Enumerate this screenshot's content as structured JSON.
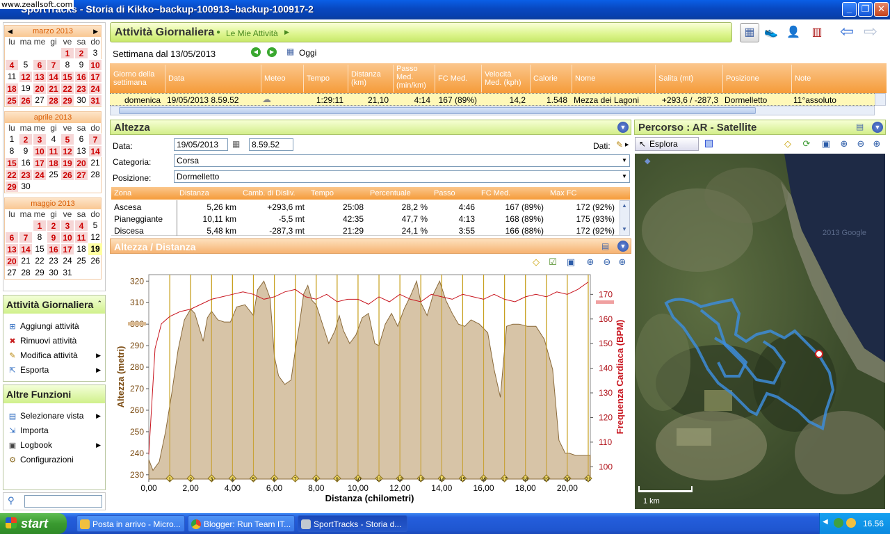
{
  "window": {
    "title": "SportTracks - Storia di Kikko~backup-100913~backup-100917-2",
    "watermark": "www.zeallsoft.com"
  },
  "calendar": {
    "weekdays": [
      "lu",
      "ma",
      "me",
      "gi",
      "ve",
      "sa",
      "do"
    ],
    "months": [
      {
        "name": "marzo 2013",
        "days": [
          "",
          "",
          "",
          "",
          "1",
          "2",
          "3",
          "4",
          "5",
          "6",
          "7",
          "8",
          "9",
          "10",
          "11",
          "12",
          "13",
          "14",
          "15",
          "16",
          "17",
          "18",
          "19",
          "20",
          "21",
          "22",
          "23",
          "24",
          "25",
          "26",
          "27",
          "28",
          "29",
          "30",
          "31"
        ]
      },
      {
        "name": "aprile 2013",
        "days": [
          "1",
          "2",
          "3",
          "4",
          "5",
          "6",
          "7",
          "8",
          "9",
          "10",
          "11",
          "12",
          "13",
          "14",
          "15",
          "16",
          "17",
          "18",
          "19",
          "20",
          "21",
          "22",
          "23",
          "24",
          "25",
          "26",
          "27",
          "28",
          "29",
          "30"
        ]
      },
      {
        "name": "maggio 2013",
        "days": [
          "",
          "",
          "1",
          "2",
          "3",
          "4",
          "5",
          "6",
          "7",
          "8",
          "9",
          "10",
          "11",
          "12",
          "13",
          "14",
          "15",
          "16",
          "17",
          "18",
          "19",
          "20",
          "21",
          "22",
          "23",
          "24",
          "25",
          "26",
          "27",
          "28",
          "29",
          "30",
          "31"
        ]
      }
    ]
  },
  "sidebar": {
    "section1": {
      "title": "Attività Giornaliera",
      "items": [
        {
          "label": "Aggiungi attività",
          "icon": "add-icon"
        },
        {
          "label": "Rimuovi attività",
          "icon": "remove-icon"
        },
        {
          "label": "Modifica attività",
          "icon": "pencil-icon"
        },
        {
          "label": "Esporta",
          "icon": "export-icon"
        }
      ]
    },
    "section2": {
      "title": "Altre Funzioni",
      "items": [
        {
          "label": "Selezionare vista",
          "icon": "view-icon"
        },
        {
          "label": "Importa",
          "icon": "import-icon"
        },
        {
          "label": "Logbook",
          "icon": "logbook-icon"
        },
        {
          "label": "Configurazioni",
          "icon": "gear-icon"
        }
      ]
    }
  },
  "header": {
    "title": "Attività Giornaliera",
    "crumb": "Le Mie Attività"
  },
  "week": {
    "label": "Settimana dal 13/05/2013",
    "today": "Oggi"
  },
  "activities": {
    "columns": [
      "Giorno della settimana",
      "Data",
      "Meteo",
      "Tempo",
      "Distanza (km)",
      "Passo Med. (min/km)",
      "FC Med.",
      "Velocità Med. (kph)",
      "Calorie",
      "Nome",
      "Salita (mt)",
      "Posizione",
      "Note"
    ],
    "row": [
      "domenica",
      "19/05/2013 8.59.52",
      "",
      "1:29:11",
      "21,10",
      "4:14",
      "167 (89%)",
      "14,2",
      "1.548",
      "Mezza dei Lagoni",
      "+293,6 / -287,3",
      "Dormelletto",
      "11°assoluto"
    ]
  },
  "altezza": {
    "title": "Altezza",
    "data_label": "Data:",
    "date": "19/05/2013",
    "time": "8.59.52",
    "dati_label": "Dati:",
    "categoria_label": "Categoria:",
    "categoria": "Corsa",
    "posizione_label": "Posizione:",
    "posizione": "Dormelletto",
    "columns": [
      "Zona",
      "Distanza",
      "Camb. di Disliv.",
      "Tempo",
      "Percentuale",
      "Passo",
      "FC Med.",
      "Max FC"
    ],
    "rows": [
      [
        "Ascesa",
        "5,26 km",
        "+293,6 mt",
        "25:08",
        "28,2 %",
        "4:46",
        "167 (89%)",
        "172 (92%)"
      ],
      [
        "Pianeggiante",
        "10,11 km",
        "-5,5 mt",
        "42:35",
        "47,7 %",
        "4:13",
        "168 (89%)",
        "175 (93%)"
      ],
      [
        "Discesa",
        "5,48 km",
        "-287,3 mt",
        "21:29",
        "24,1 %",
        "3:55",
        "166 (88%)",
        "172 (92%)"
      ]
    ]
  },
  "chartpanel": {
    "title": "Altezza / Distanza"
  },
  "chart_data": {
    "type": "area",
    "xlabel": "Distanza (chilometri)",
    "ylabel": "Altezza (metri)",
    "y2label": "Frequenza Cardiaca (BPM)",
    "xlim": [
      0,
      21.1
    ],
    "ylim": [
      228,
      323
    ],
    "y2lim": [
      95,
      178
    ],
    "xticks": [
      "0,00",
      "2,00",
      "4,00",
      "6,00",
      "8,00",
      "10,00",
      "12,00",
      "14,00",
      "16,00",
      "18,00",
      "20,00"
    ],
    "yticks": [
      230,
      240,
      250,
      260,
      270,
      280,
      290,
      300,
      310,
      320
    ],
    "y2ticks": [
      100,
      110,
      120,
      130,
      140,
      150,
      160,
      170
    ],
    "km_markers": [
      "1",
      "2",
      "3",
      "4",
      "5",
      "6",
      "7",
      "8",
      "9",
      "10",
      "11",
      "12",
      "13",
      "14",
      "15",
      "16",
      "17",
      "18",
      "19",
      "20",
      "21"
    ],
    "series": [
      {
        "name": "Altezza",
        "x": [
          0,
          0.2,
          0.5,
          0.8,
          1.1,
          1.4,
          1.7,
          2.0,
          2.2,
          2.6,
          2.8,
          3.0,
          3.3,
          3.6,
          3.9,
          4.2,
          4.6,
          5.0,
          5.2,
          5.5,
          5.8,
          6.0,
          6.2,
          6.5,
          6.8,
          7.0,
          7.2,
          7.4,
          7.6,
          7.8,
          8.0,
          8.2,
          8.4,
          8.6,
          8.9,
          9.1,
          9.3,
          9.6,
          9.9,
          10.2,
          10.5,
          10.8,
          11.0,
          11.3,
          11.6,
          11.9,
          12.2,
          12.5,
          12.8,
          13.0,
          13.3,
          13.6,
          13.9,
          14.2,
          14.5,
          14.8,
          15.1,
          15.4,
          15.8,
          16.2,
          16.5,
          16.8,
          17.1,
          17.4,
          17.7,
          18.1,
          18.5,
          18.9,
          19.3,
          19.6,
          19.9,
          20.1,
          20.4,
          20.8,
          21.1
        ],
        "values": [
          237,
          232,
          236,
          250,
          268,
          288,
          302,
          307,
          305,
          292,
          303,
          306,
          302,
          301,
          301,
          308,
          309,
          304,
          316,
          320,
          312,
          285,
          276,
          272,
          274,
          288,
          300,
          314,
          318,
          311,
          309,
          303,
          297,
          291,
          297,
          304,
          297,
          291,
          295,
          303,
          305,
          291,
          290,
          300,
          305,
          299,
          307,
          313,
          320,
          310,
          304,
          314,
          320,
          311,
          305,
          300,
          299,
          302,
          300,
          296,
          279,
          266,
          299,
          300,
          300,
          299,
          299,
          293,
          279,
          246,
          240,
          240,
          239,
          239,
          239
        ]
      },
      {
        "name": "Frequenza Cardiaca",
        "x": [
          0,
          0.3,
          0.6,
          1.0,
          1.5,
          2.0,
          2.5,
          3.0,
          3.5,
          4.0,
          4.5,
          5.0,
          5.5,
          6.0,
          6.5,
          7.0,
          7.5,
          8.0,
          8.5,
          9.0,
          9.5,
          10.0,
          10.5,
          11.0,
          11.5,
          12.0,
          12.5,
          13.0,
          13.5,
          14.0,
          14.5,
          15.0,
          15.5,
          16.0,
          16.5,
          17.0,
          17.5,
          18.0,
          18.5,
          19.0,
          19.5,
          20.0,
          20.5,
          21.0
        ],
        "values": [
          105,
          148,
          158,
          161,
          163,
          164,
          166,
          168,
          169,
          170,
          171,
          170,
          168,
          169,
          171,
          172,
          169,
          168,
          170,
          167,
          168,
          168,
          166,
          169,
          167,
          170,
          168,
          167,
          170,
          169,
          168,
          170,
          169,
          168,
          170,
          168,
          167,
          169,
          170,
          169,
          171,
          170,
          172,
          175
        ]
      }
    ]
  },
  "map": {
    "title": "Percorso  : AR - Satellite",
    "explore": "Esplora",
    "scale": "1 km",
    "copyright": "2013 Google"
  },
  "taskbar": {
    "start": "start",
    "tasks": [
      "Posta in arrivo - Micro...",
      "Blogger: Run Team IT...",
      "SportTracks - Storia d..."
    ],
    "clock": "16.56"
  },
  "colors": {
    "accent": "#f59b39",
    "panel": "#d6f07a",
    "hr": "#c8141e",
    "elev_fill": "#c9b08a"
  }
}
